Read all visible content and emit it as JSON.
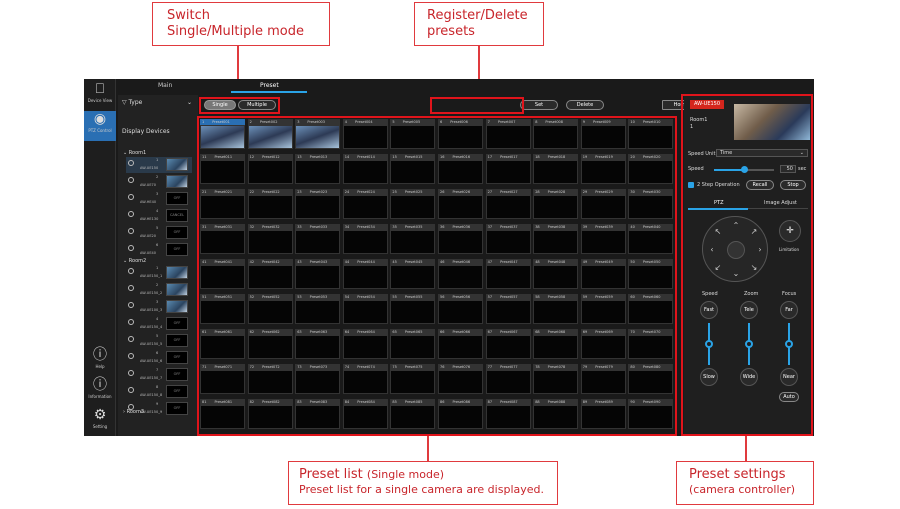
{
  "callouts": {
    "switch": {
      "line1": "Switch",
      "line2": "Single/Multiple mode"
    },
    "register": {
      "line1": "Register/Delete",
      "line2": "presets"
    },
    "preset_list": {
      "line1": "Preset list",
      "line1_suffix": "(Single mode)",
      "line2": "Preset list for a single camera are displayed."
    },
    "preset_settings": {
      "line1": "Preset settings",
      "line2": "(camera controller)"
    }
  },
  "leftbar": {
    "items": [
      {
        "label": "Device View",
        "icon": "monitor-icon"
      },
      {
        "label": "PTZ Control",
        "icon": "camera-icon"
      },
      {
        "label": "Help",
        "icon": "help-icon"
      },
      {
        "label": "Information",
        "icon": "info-icon"
      },
      {
        "label": "Setting",
        "icon": "gear-icon"
      }
    ]
  },
  "tabs": {
    "main": "Main",
    "preset": "Preset"
  },
  "panel": {
    "type_label": "Type",
    "display_devices": "Display Devices",
    "room1": "Room1",
    "room2": "Room2",
    "room3": "Room3",
    "room1_devices": [
      {
        "num": "1",
        "name": "AW-UE150",
        "thumb": ""
      },
      {
        "num": "2",
        "name": "AW-UE70",
        "thumb": ""
      },
      {
        "num": "3",
        "name": "AW-HE40",
        "thumb": "OFF"
      },
      {
        "num": "4",
        "name": "AW-HE130",
        "thumb": "CANCEL"
      },
      {
        "num": "5",
        "name": "AW-UE20",
        "thumb": "OFF"
      },
      {
        "num": "6",
        "name": "AW-UE40",
        "thumb": "OFF"
      }
    ],
    "room2_devices": [
      {
        "num": "1",
        "name": "AW-UE150_1",
        "thumb": ""
      },
      {
        "num": "2",
        "name": "AW-UE150_2",
        "thumb": ""
      },
      {
        "num": "3",
        "name": "AW-UE100_3",
        "thumb": ""
      },
      {
        "num": "4",
        "name": "AW-UE150_4",
        "thumb": "OFF"
      },
      {
        "num": "5",
        "name": "AW-UE150_5",
        "thumb": "OFF"
      },
      {
        "num": "6",
        "name": "AW-UE150_6",
        "thumb": "OFF"
      },
      {
        "num": "7",
        "name": "AW-UE150_7",
        "thumb": "OFF"
      },
      {
        "num": "8",
        "name": "AW-UE150_8",
        "thumb": "OFF"
      },
      {
        "num": "9",
        "name": "AW-UE150_9",
        "thumb": "OFF"
      }
    ]
  },
  "toolbar": {
    "single": "Single",
    "multiple": "Multiple",
    "set": "Set",
    "delete": "Delete",
    "home": "Home"
  },
  "presets": {
    "rows": 9,
    "cols": 10,
    "prefix": "Preset",
    "image_cells": [
      1,
      2,
      3
    ]
  },
  "controller": {
    "camera_badge": "AW-UE150",
    "room": "Room1",
    "room_num": "1",
    "speed_unit_label": "Speed Unit",
    "speed_unit_value": "Time",
    "speed_label": "Speed",
    "speed_value": "50",
    "speed_unit": "sec",
    "speed_level": 0.5,
    "two_step": "2 Step Operation",
    "recall": "Recall",
    "stop": "Stop",
    "tab_ptz": "PTZ",
    "tab_image": "Image Adjust",
    "limitation": "Limitation",
    "speed": "Speed",
    "zoom": "Zoom",
    "focus": "Focus",
    "fast": "Fast",
    "tele": "Tele",
    "far": "Far",
    "slow": "Slow",
    "wide": "Wide",
    "near": "Near",
    "auto": "Auto"
  }
}
